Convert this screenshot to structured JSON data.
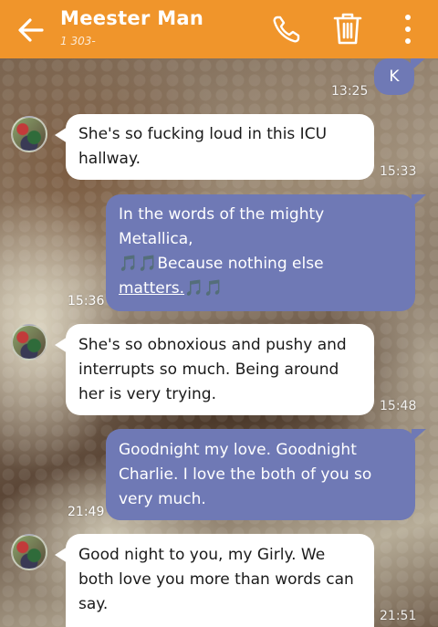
{
  "header": {
    "title": "Meester Man",
    "subtitle": "1 303-",
    "accent": "#f0952b"
  },
  "icons": {
    "back": "arrow-left-icon",
    "call": "phone-icon",
    "delete": "trash-icon",
    "menu": "more-vert-icon"
  },
  "messages": [
    {
      "side": "out",
      "text": "K",
      "time": "13:25"
    },
    {
      "side": "in",
      "text": "She's so fucking loud in this ICU hallway.",
      "time": "15:33"
    },
    {
      "side": "out",
      "text_line1": "In the words of the mighty",
      "text_line2": "Metallica,",
      "emoji": "🎵🎵",
      "text_line3": "Because nothing else",
      "text_line4": "matters.",
      "time": "15:36"
    },
    {
      "side": "in",
      "text": "She's so obnoxious and pushy and interrupts so much.  Being around her is very trying.",
      "time": "15:48"
    },
    {
      "side": "out",
      "text": "Goodnight my love. Goodnight Charlie. I love the both of you so very much.",
      "time": "21:49"
    },
    {
      "side": "in",
      "text": "Good night to you, my Girly.  We both love you more than words can say.",
      "time": "21:51"
    }
  ],
  "colors": {
    "incoming_bubble": "#ffffff",
    "outgoing_bubble": "#6f79b5"
  }
}
